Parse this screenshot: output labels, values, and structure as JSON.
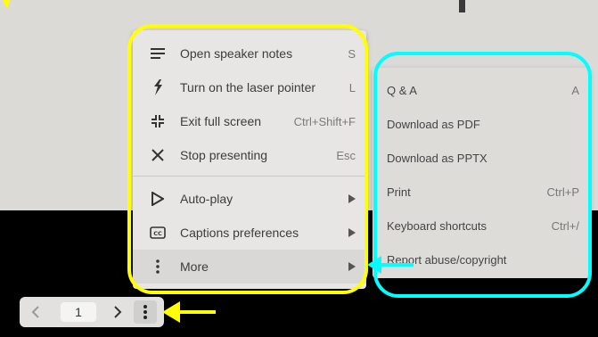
{
  "main_menu": {
    "items": [
      {
        "label": "Open speaker notes",
        "shortcut": "S",
        "icon": "lines-icon"
      },
      {
        "label": "Turn on the laser pointer",
        "shortcut": "L",
        "icon": "laser-pointer-icon"
      },
      {
        "label": "Exit full screen",
        "shortcut": "Ctrl+Shift+F",
        "icon": "exit-fullscreen-icon"
      },
      {
        "label": "Stop presenting",
        "shortcut": "Esc",
        "icon": "close-icon"
      },
      {
        "label": "Auto-play",
        "icon": "play-icon"
      },
      {
        "label": "Captions preferences",
        "icon": "cc-icon"
      },
      {
        "label": "More",
        "icon": "more-vertical-icon"
      }
    ]
  },
  "sub_menu": {
    "items": [
      {
        "label": "Q & A",
        "shortcut": "A"
      },
      {
        "label": "Download as PDF",
        "shortcut": ""
      },
      {
        "label": "Download as PPTX",
        "shortcut": ""
      },
      {
        "label": "Print",
        "shortcut": "Ctrl+P"
      },
      {
        "label": "Keyboard shortcuts",
        "shortcut": "Ctrl+/"
      },
      {
        "label": "Report abuse/copyright",
        "shortcut": ""
      }
    ]
  },
  "nav": {
    "prev_icon": "chevron-left-icon",
    "page": "1",
    "next_icon": "chevron-right-icon",
    "more_icon": "more-vertical-icon"
  },
  "annotations": {
    "yellow": "#ffff00",
    "cyan": "#00ffff"
  }
}
